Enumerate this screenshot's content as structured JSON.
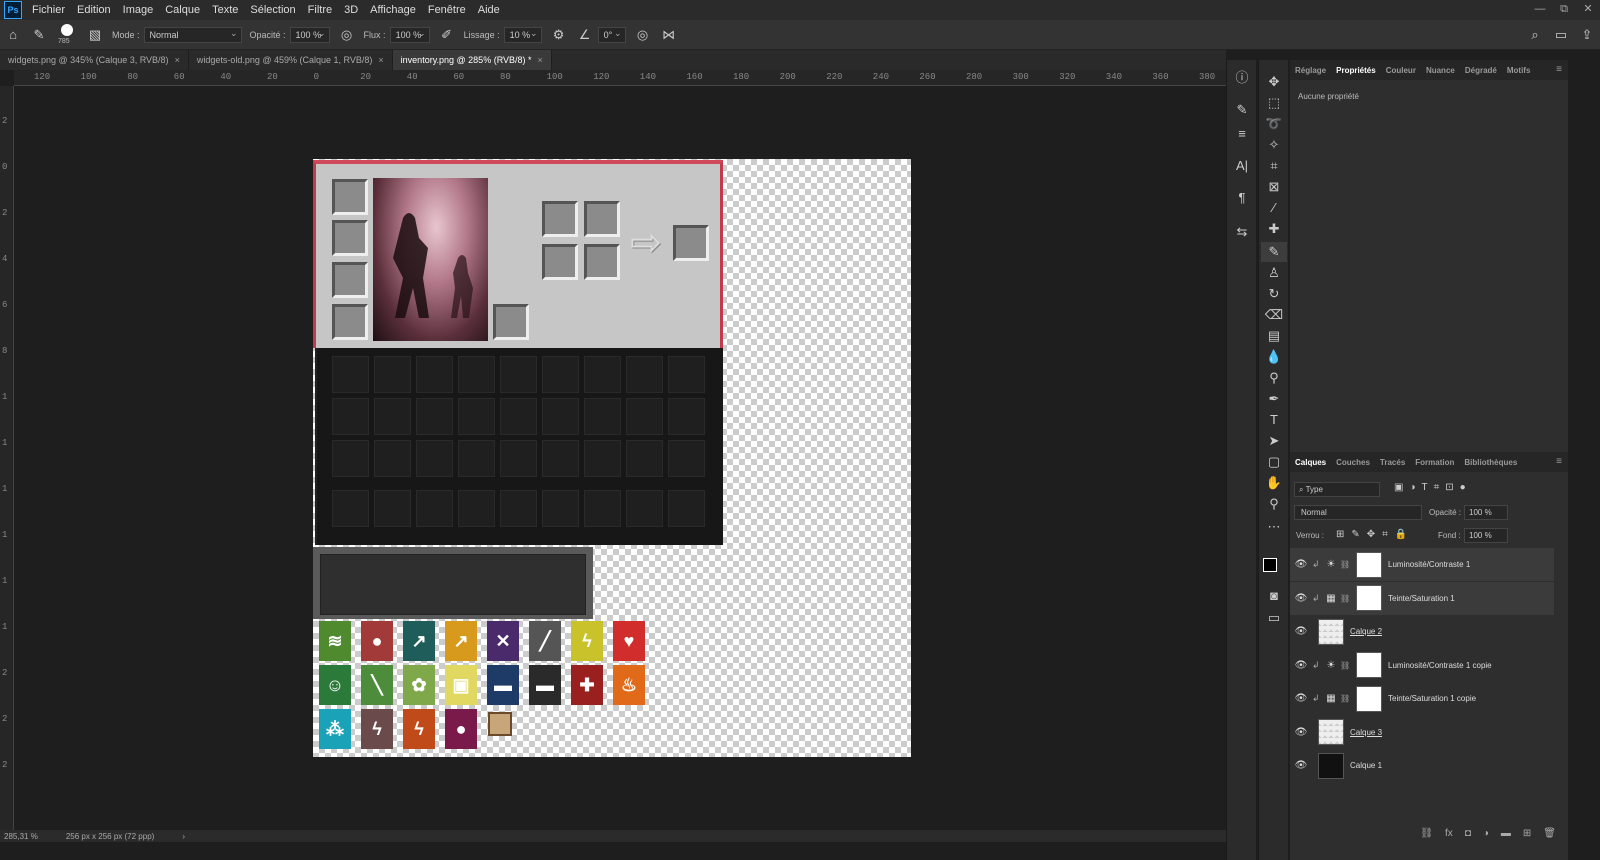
{
  "app": {
    "logo": "Ps"
  },
  "menu": [
    "Fichier",
    "Edition",
    "Image",
    "Calque",
    "Texte",
    "Sélection",
    "Filtre",
    "3D",
    "Affichage",
    "Fenêtre",
    "Aide"
  ],
  "window_controls": [
    "—",
    "⧉",
    "✕"
  ],
  "options": {
    "brush_size": "785",
    "mode_label": "Mode :",
    "mode_value": "Normal",
    "opacity_label": "Opacité :",
    "opacity_value": "100 %",
    "flow_label": "Flux :",
    "flow_value": "100 %",
    "smoothing_label": "Lissage :",
    "smoothing_value": "10 %",
    "angle_value": "0°"
  },
  "tabs": [
    {
      "label": "widgets.png @ 345% (Calque 3, RVB/8)",
      "active": false
    },
    {
      "label": "widgets-old.png @ 459% (Calque 1, RVB/8)",
      "active": false
    },
    {
      "label": "inventory.png @ 285% (RVB/8) *",
      "active": true
    }
  ],
  "ruler_h": [
    "120",
    "100",
    "80",
    "60",
    "40",
    "20",
    "0",
    "20",
    "40",
    "60",
    "80",
    "100",
    "120",
    "140",
    "160",
    "180",
    "200",
    "220",
    "240",
    "260",
    "280",
    "300",
    "320",
    "340",
    "360",
    "380"
  ],
  "ruler_v": [
    "2",
    "0",
    "2",
    "4",
    "6",
    "8",
    "1",
    "1",
    "1",
    "1",
    "1",
    "1",
    "2",
    "2",
    "2"
  ],
  "status": {
    "zoom": "285,31 %",
    "doc_size": "256 px x 256 px (72 ppp)",
    "arrow": "›"
  },
  "properties_panel": {
    "tabs": [
      "Réglage",
      "Propriétés",
      "Couleur",
      "Nuance",
      "Dégradé",
      "Motifs"
    ],
    "active_tab": "Propriétés",
    "empty_text": "Aucune propriété"
  },
  "layers_panel": {
    "tabs": [
      "Calques",
      "Couches",
      "Tracés",
      "Formation",
      "Bibliothèques"
    ],
    "active_tab": "Calques",
    "filter_label": "Type",
    "blend_mode": "Normal",
    "opacity_label": "Opacité :",
    "opacity_value": "100 %",
    "lock_label": "Verrou :",
    "fill_label": "Fond :",
    "fill_value": "100 %",
    "layers": [
      {
        "name": "Luminosité/Contraste 1",
        "type": "adjust-brightness",
        "clipped": true,
        "thumb": "white",
        "selected": true,
        "underline": false
      },
      {
        "name": "Teinte/Saturation 1",
        "type": "adjust-hue",
        "clipped": true,
        "thumb": "white",
        "selected": true,
        "underline": false
      },
      {
        "name": "Calque 2",
        "type": "pixel",
        "clipped": false,
        "thumb": "check",
        "selected": false,
        "underline": true
      },
      {
        "name": "Luminosité/Contraste 1 copie",
        "type": "adjust-brightness",
        "clipped": true,
        "thumb": "white",
        "selected": false,
        "underline": false
      },
      {
        "name": "Teinte/Saturation 1 copie",
        "type": "adjust-hue",
        "clipped": true,
        "thumb": "white",
        "selected": false,
        "underline": false
      },
      {
        "name": "Calque 3",
        "type": "pixel",
        "clipped": false,
        "thumb": "check",
        "selected": false,
        "underline": true
      },
      {
        "name": "Calque 1",
        "type": "pixel",
        "clipped": false,
        "thumb": "dark",
        "selected": false,
        "underline": false
      }
    ]
  },
  "effect_icons": [
    {
      "color": "#4f8a2e",
      "glyph": "≋"
    },
    {
      "color": "#a33a3a",
      "glyph": "●"
    },
    {
      "color": "#1f5d5a",
      "glyph": "↗"
    },
    {
      "color": "#d89a1c",
      "glyph": "↗"
    },
    {
      "color": "#4a2a6a",
      "glyph": "✕"
    },
    {
      "color": "#555555",
      "glyph": "╱"
    },
    {
      "color": "#c9c22a",
      "glyph": "ϟ"
    },
    {
      "color": "#d12d2d",
      "glyph": "♥"
    },
    {
      "color": "#2c7a3a",
      "glyph": "☺"
    },
    {
      "color": "#4c8c3a",
      "glyph": "╲"
    },
    {
      "color": "#7fa84a",
      "glyph": "✿"
    },
    {
      "color": "#e0d860",
      "glyph": "▣"
    },
    {
      "color": "#1e3a66",
      "glyph": "▬"
    },
    {
      "color": "#2a2a2a",
      "glyph": "▬"
    },
    {
      "color": "#9a2020",
      "glyph": "✚"
    },
    {
      "color": "#e06a1a",
      "glyph": "♨"
    },
    {
      "color": "#1aa3b8",
      "glyph": "⁂"
    },
    {
      "color": "#6a4a4a",
      "glyph": "ϟ"
    },
    {
      "color": "#c04a1a",
      "glyph": "ϟ"
    },
    {
      "color": "#7a1a4a",
      "glyph": "●"
    }
  ],
  "accent": "#d04a5c"
}
